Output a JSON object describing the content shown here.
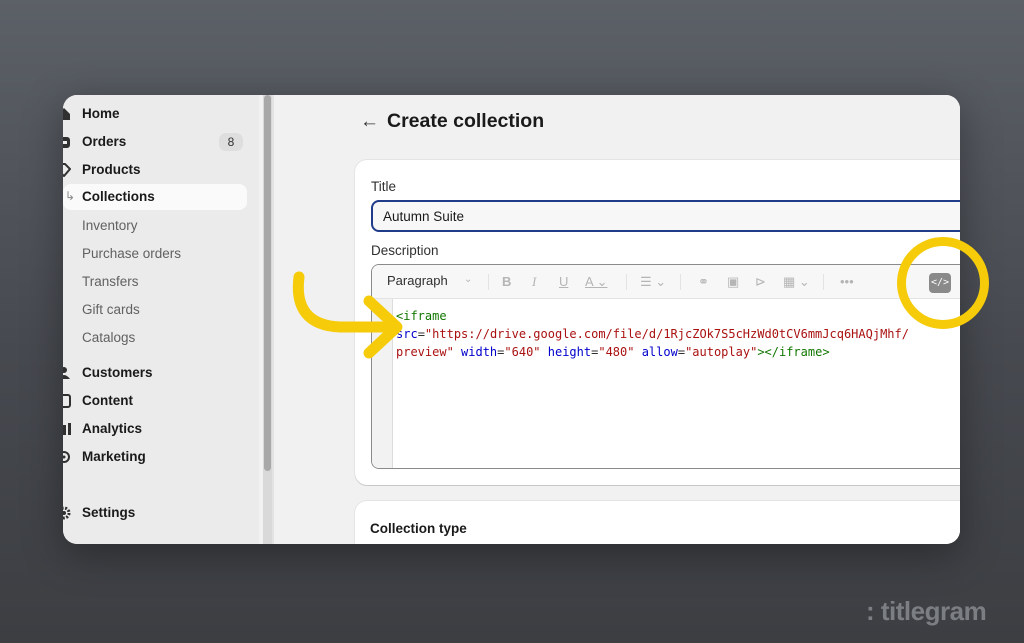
{
  "sidebar": {
    "items": [
      {
        "label": "Home",
        "icon": "home-icon"
      },
      {
        "label": "Orders",
        "icon": "orders-icon",
        "badge": "8"
      },
      {
        "label": "Products",
        "icon": "tag-icon"
      },
      {
        "label": "Collections"
      },
      {
        "label": "Inventory"
      },
      {
        "label": "Purchase orders"
      },
      {
        "label": "Transfers"
      },
      {
        "label": "Gift cards"
      },
      {
        "label": "Catalogs"
      },
      {
        "label": "Customers",
        "icon": "person-icon"
      },
      {
        "label": "Content",
        "icon": "content-icon"
      },
      {
        "label": "Analytics",
        "icon": "bar-chart-icon"
      },
      {
        "label": "Marketing",
        "icon": "target-icon"
      },
      {
        "label": "Settings",
        "icon": "gear-icon"
      }
    ]
  },
  "header": {
    "title": "Create collection"
  },
  "form": {
    "title_label": "Title",
    "title_value": "Autumn Suite",
    "description_label": "Description",
    "toolbar": {
      "paragraph": "Paragraph",
      "code_toggle": "</>"
    },
    "code": {
      "open_tag": "<iframe",
      "src_attr": "src",
      "src_value_1": "\"https://drive.google.com/file/d/1RjcZOk7S5cHzWd0tCV6mmJcq6HAQjMhf/",
      "src_value_2": "preview\"",
      "width_attr": "width",
      "width_value": "\"640\"",
      "height_attr": "height",
      "height_value": "\"480\"",
      "allow_attr": "allow",
      "allow_value": "\"autoplay\"",
      "close_tag": "></iframe>",
      "equals": "="
    }
  },
  "collection_type": {
    "label": "Collection type"
  },
  "brand": {
    "text": ": titlegram"
  },
  "colors": {
    "highlight": "#f5cb0a",
    "accent": "#1f3b8a",
    "page_bg": "#4a4d53"
  }
}
